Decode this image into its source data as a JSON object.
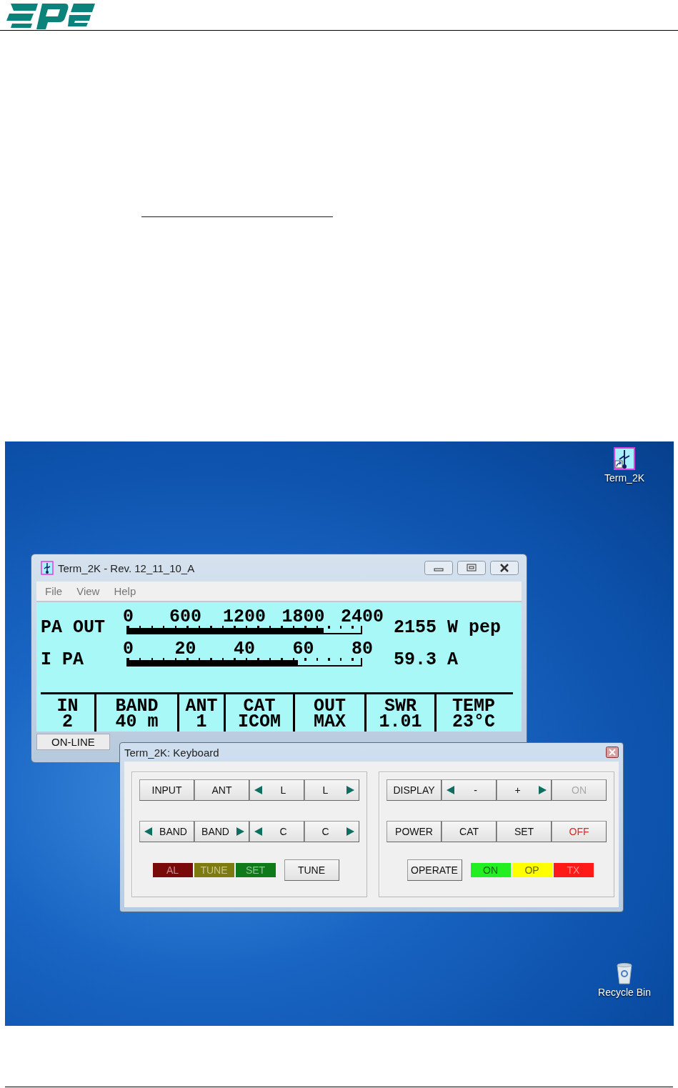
{
  "desktop": {
    "icons": [
      {
        "label": "Term_2K",
        "kind": "app"
      },
      {
        "label": "Recycle Bin",
        "kind": "recycle"
      }
    ]
  },
  "main_window": {
    "title": "Term_2K - Rev. 12_11_10_A",
    "menu": [
      "File",
      "View",
      "Help"
    ],
    "meters": [
      {
        "label": "PA OUT",
        "scale": [
          "0",
          "600",
          "1200",
          "1800",
          "2400"
        ],
        "level": 0.84,
        "reading": "2155 W pep"
      },
      {
        "label": "I PA",
        "scale": [
          "0",
          "20",
          "40",
          "60",
          "80"
        ],
        "level": 0.73,
        "reading": "59.3 A"
      }
    ],
    "status_cells": [
      {
        "label": "IN",
        "value": "2"
      },
      {
        "label": "BAND",
        "value": "40 m"
      },
      {
        "label": "ANT",
        "value": "1"
      },
      {
        "label": "CAT",
        "value": "ICOM"
      },
      {
        "label": "OUT",
        "value": "MAX"
      },
      {
        "label": "SWR",
        "value": "1.01"
      },
      {
        "label": "TEMP",
        "value": "23°C"
      }
    ],
    "status_bar": "ON-LINE"
  },
  "keyboard_window": {
    "title": "Term_2K: Keyboard",
    "groups": [
      {
        "rows": [
          [
            {
              "kind": "button",
              "label": "INPUT",
              "disabled": false
            },
            {
              "kind": "button",
              "label": "ANT",
              "disabled": false
            },
            {
              "kind": "leftarrow",
              "label": "L",
              "disabled": false
            },
            {
              "kind": "rightarrow",
              "label": "L",
              "disabled": false
            }
          ],
          [
            {
              "kind": "leftarrow",
              "label": "BAND",
              "disabled": false
            },
            {
              "kind": "rightarrow",
              "label": "BAND",
              "disabled": false
            },
            {
              "kind": "leftarrow",
              "label": "C",
              "disabled": false
            },
            {
              "kind": "rightarrow",
              "label": "C",
              "disabled": false
            }
          ],
          [
            {
              "kind": "indicator",
              "label": "AL",
              "color": "#7a0a0a"
            },
            {
              "kind": "indicator",
              "label": "TUNE",
              "color": "#7d7a10"
            },
            {
              "kind": "indicator",
              "label": "SET",
              "color": "#0f7a1a"
            },
            {
              "kind": "button",
              "label": "TUNE",
              "disabled": false
            }
          ]
        ]
      },
      {
        "rows": [
          [
            {
              "kind": "button",
              "label": "DISPLAY",
              "disabled": false
            },
            {
              "kind": "leftarrow",
              "label": "-",
              "disabled": false
            },
            {
              "kind": "rightarrow",
              "label": "+",
              "disabled": false
            },
            {
              "kind": "button",
              "label": "ON",
              "disabled": true
            }
          ],
          [
            {
              "kind": "button",
              "label": "POWER",
              "disabled": false
            },
            {
              "kind": "button",
              "label": "CAT",
              "disabled": false
            },
            {
              "kind": "button",
              "label": "SET",
              "disabled": false
            },
            {
              "kind": "button",
              "label": "OFF",
              "color": "#e02828",
              "disabled": false
            }
          ],
          [
            {
              "kind": "button",
              "label": "OPERATE",
              "disabled": false
            },
            {
              "kind": "indicator",
              "label": "ON",
              "color": "#22ee22"
            },
            {
              "kind": "indicator",
              "label": "OP",
              "color": "#ffff00"
            },
            {
              "kind": "indicator",
              "label": "TX",
              "color": "#ff1a1a"
            }
          ]
        ]
      }
    ]
  }
}
